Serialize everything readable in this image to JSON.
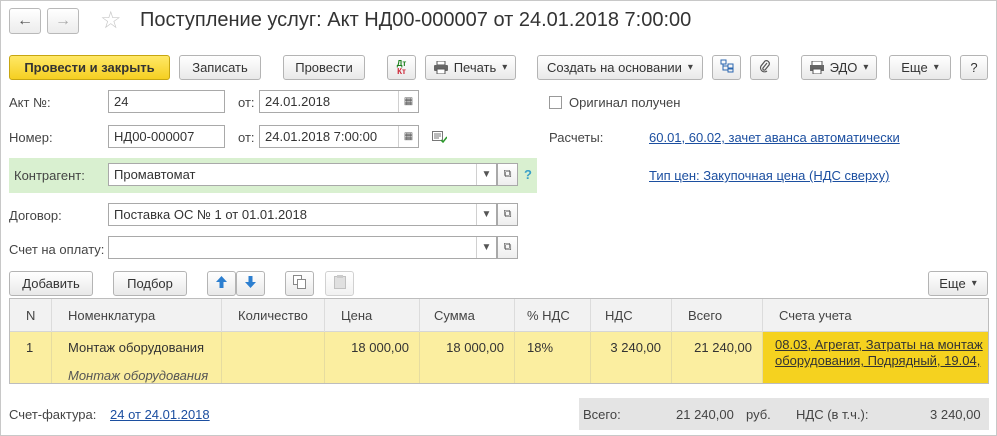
{
  "title": "Поступление услуг: Акт НД00-000007 от 24.01.2018 7:00:00",
  "nav": {
    "back": "←",
    "forward": "→",
    "favorite": "☆"
  },
  "toolbar": {
    "post_close": "Провести и закрыть",
    "save": "Записать",
    "post": "Провести",
    "dt_kt": "Дт/Кт",
    "print": "Печать",
    "create_based": "Создать на основании",
    "edo": "ЭДО",
    "more": "Еще",
    "help": "?"
  },
  "form": {
    "act_no_label": "Акт №:",
    "act_no_value": "24",
    "from1_label": "от:",
    "from1_value": "24.01.2018",
    "original_label": "Оригинал получен",
    "number_label": "Номер:",
    "number_value": "НД00-000007",
    "from2_label": "от:",
    "from2_value": "24.01.2018  7:00:00",
    "settlements_label": "Расчеты:",
    "settlements_link": "60.01, 60.02, зачет аванса автоматически",
    "contractor_label": "Контрагент:",
    "contractor_value": "Промавтомат",
    "contractor_help": "?",
    "price_type_link": "Тип цен: Закупочная цена (НДС сверху)",
    "contract_label": "Договор:",
    "contract_value": "Поставка ОС № 1 от 01.01.2018",
    "invoice_label": "Счет на оплату:",
    "invoice_value": ""
  },
  "table_toolbar": {
    "add": "Добавить",
    "select": "Подбор",
    "more": "Еще"
  },
  "table": {
    "headers": [
      "N",
      "Номенклатура",
      "Количество",
      "Цена",
      "Сумма",
      "% НДС",
      "НДС",
      "Всего",
      "Счета учета"
    ],
    "row": {
      "n": "1",
      "item": "Монтаж оборудования",
      "item_sub": "Монтаж оборудования",
      "qty": "",
      "price": "18 000,00",
      "sum": "18 000,00",
      "vat_rate": "18%",
      "vat": "3 240,00",
      "total": "21 240,00",
      "accounts_line1": "08.03, Агрегат, Затраты на монтаж",
      "accounts_line2": "оборудования, Подрядный, 19.04,"
    }
  },
  "footer": {
    "invoice_label": "Счет-фактура:",
    "invoice_link": "24 от 24.01.2018",
    "total_label": "Всего:",
    "total_value": "21 240,00",
    "currency": "руб.",
    "vat_label": "НДС (в т.ч.):",
    "vat_value": "3 240,00"
  },
  "colors": {
    "primary": "#f5cf21",
    "row": "#fbeea0",
    "active_cell": "#f5d21f",
    "link": "#1c4fa0",
    "contractor_bg": "#d9f0d0"
  }
}
